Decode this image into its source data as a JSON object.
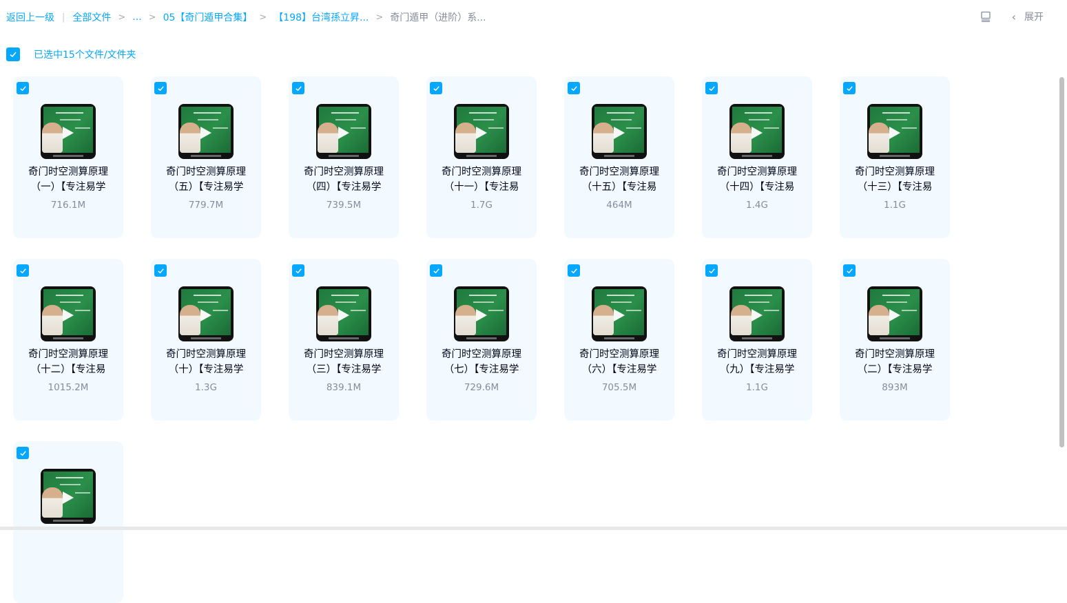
{
  "breadcrumb": {
    "back": "返回上一级",
    "all_files": "全部文件",
    "ellipsis": "...",
    "level1": "05【奇门遁甲合集】",
    "level2": "【198】台湾孫立昇...",
    "current": "奇门遁甲（进阶）系..."
  },
  "toolbar": {
    "list_view_icon": "list-view-icon",
    "expand_label": "展开",
    "chevron": "‹"
  },
  "selection": {
    "label": "已选中15个文件/文件夹"
  },
  "colors": {
    "accent": "#06a7ff",
    "card_bg": "#f2f9ff",
    "text_primary": "#03081a",
    "text_secondary": "#878c9c"
  },
  "files": [
    {
      "line1": "奇门时空测算原理",
      "line2": "（一）【专注易学",
      "size": "716.1M"
    },
    {
      "line1": "奇门时空测算原理",
      "line2": "（五）【专注易学",
      "size": "779.7M"
    },
    {
      "line1": "奇门时空测算原理",
      "line2": "（四）【专注易学",
      "size": "739.5M"
    },
    {
      "line1": "奇门时空测算原理",
      "line2": "（十一）【专注易",
      "size": "1.7G"
    },
    {
      "line1": "奇门时空测算原理",
      "line2": "（十五）【专注易",
      "size": "464M"
    },
    {
      "line1": "奇门时空测算原理",
      "line2": "（十四）【专注易",
      "size": "1.4G"
    },
    {
      "line1": "奇门时空测算原理",
      "line2": "（十三）【专注易",
      "size": "1.1G"
    },
    {
      "line1": "奇门时空测算原理",
      "line2": "（十二）【专注易",
      "size": "1015.2M"
    },
    {
      "line1": "奇门时空测算原理",
      "line2": "（十）【专注易学",
      "size": "1.3G"
    },
    {
      "line1": "奇门时空测算原理",
      "line2": "（三）【专注易学",
      "size": "839.1M"
    },
    {
      "line1": "奇门时空测算原理",
      "line2": "（七）【专注易学",
      "size": "729.6M"
    },
    {
      "line1": "奇门时空测算原理",
      "line2": "（六）【专注易学",
      "size": "705.5M"
    },
    {
      "line1": "奇门时空测算原理",
      "line2": "（九）【专注易学",
      "size": "1.1G"
    },
    {
      "line1": "奇门时空测算原理",
      "line2": "（二）【专注易学",
      "size": "893M"
    },
    {
      "line1": "",
      "line2": "",
      "size": ""
    }
  ]
}
